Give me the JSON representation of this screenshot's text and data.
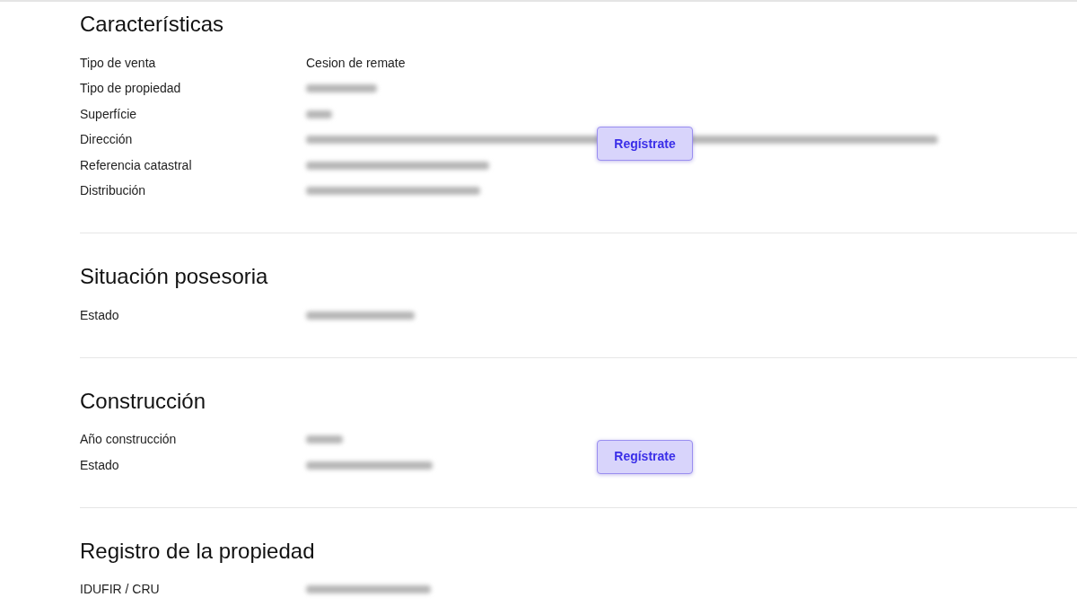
{
  "sections": [
    {
      "title": "Características",
      "button": "Regístrate",
      "rows": [
        {
          "label": "Tipo de venta",
          "kind": "text",
          "value": "Cesion de remate"
        },
        {
          "label": "Tipo de propiedad",
          "kind": "blurred"
        },
        {
          "label": "Superfície",
          "kind": "blurred"
        },
        {
          "label": "Dirección",
          "kind": "blurred"
        },
        {
          "label": "Referencia catastral",
          "kind": "blurred"
        },
        {
          "label": "Distribución",
          "kind": "blurred"
        }
      ]
    },
    {
      "title": "Situación posesoria",
      "rows": [
        {
          "label": "Estado",
          "kind": "blurred"
        }
      ]
    },
    {
      "title": "Construcción",
      "button": "Regístrate",
      "rows": [
        {
          "label": "Año construcción",
          "kind": "blurred"
        },
        {
          "label": "Estado",
          "kind": "blurred"
        }
      ]
    },
    {
      "title": "Registro de la propiedad",
      "rows": [
        {
          "label": "IDUFIR / CRU",
          "kind": "blurred"
        }
      ]
    }
  ]
}
